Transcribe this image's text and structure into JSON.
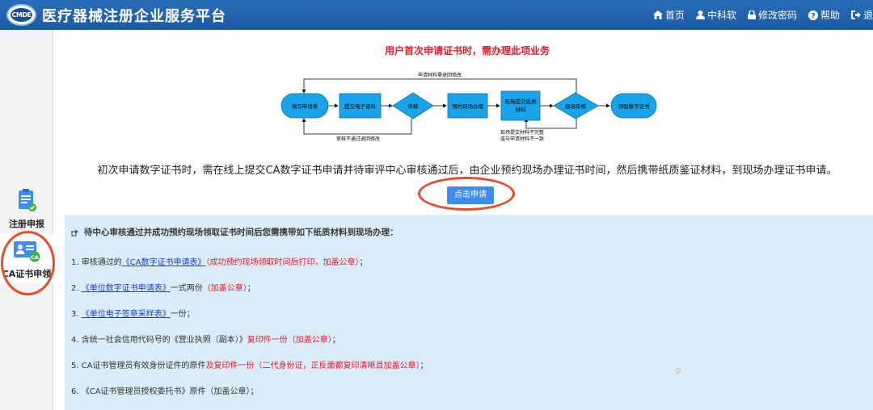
{
  "header": {
    "logo_text": "CMDE",
    "title": "医疗器械注册企业服务平台",
    "nav": [
      {
        "label": "首页",
        "icon": "home-icon"
      },
      {
        "label": "中科软",
        "icon": "user-icon"
      },
      {
        "label": "修改密码",
        "icon": "lock-icon"
      },
      {
        "label": "帮助",
        "icon": "help-icon"
      },
      {
        "label": "退",
        "icon": "logout-icon"
      }
    ]
  },
  "sidebar": {
    "items": [
      {
        "label": "注册申报",
        "icon": "clipboard-check-icon"
      },
      {
        "label": "CA证书申领",
        "icon": "ca-id-card-icon",
        "active": true
      }
    ]
  },
  "main": {
    "headline": "用户首次申请证书时，需办理此项业务",
    "flow": {
      "nodes": [
        "填写申请表",
        "提交电子资料",
        "审核",
        "预约现场办理",
        "现场提交纸质材料",
        "现场审核",
        "领取数字证书"
      ],
      "loop_top": "申请材料需退回修改",
      "loop_bottom_left": "审核不通过退回修改",
      "loop_bottom_right_1": "现场提交材料不完整",
      "loop_bottom_right_2": "或与申请材料不一致"
    },
    "description": "初次申请数字证书时，需在线上提交CA数字证书申请并待审评中心审核通过后，由企业预约现场办理证书时间，然后携带纸质鉴证材料，到现场办理证书申请。",
    "apply_button": "点击申请",
    "panel_title": "待中心审核通过并成功预约现场领取证书时间后您需携带如下纸质材料到现场办理：",
    "requirements": [
      {
        "num": "1. 审核通过的",
        "link": "《CA数字证书申请表》",
        "rest": "",
        "red": "（成功预约现场领取时间后打印，加盖公章）",
        "tail": "；"
      },
      {
        "num": "2. ",
        "link": "《单位数字证书申请表》",
        "rest": "一式两份",
        "red": "（加盖公章）",
        "tail": "；"
      },
      {
        "num": "3. ",
        "link": "《单位电子签章采样表》",
        "rest": "一份；",
        "red": "",
        "tail": ""
      },
      {
        "num": "4. 含统一社会信用代码号的《营业执照（副本）》",
        "link": "",
        "rest": "",
        "red": "复印件一份（加盖公章）",
        "tail": "；"
      },
      {
        "num": "5. CA证书管理员有效身份证件的原件",
        "link": "",
        "rest": "",
        "red": "及复印件一份（二代身份证，正反面都复印清晰且加盖公章）",
        "tail": "；"
      },
      {
        "num": "6. 《CA证书管理员授权委托书》原件（加盖公章）；",
        "link": "",
        "rest": "",
        "red": "",
        "tail": ""
      }
    ]
  },
  "colors": {
    "header_blue": "#1d5aa3",
    "flow_blue": "#1aa3e8",
    "accent_red": "#e8192c",
    "panel_bg": "#d9ecf7",
    "button_blue": "#3d8ef0"
  }
}
